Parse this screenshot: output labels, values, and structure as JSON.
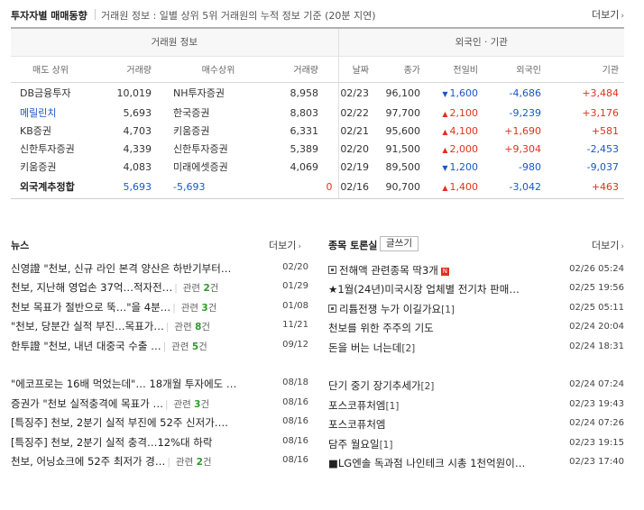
{
  "trade_section": {
    "title": "투자자별 매매동향",
    "subtitle": "거래원 정보 : 일별 상위 5위 거래원의 누적 정보 기준 (20분 지연)",
    "more_label": "더보기"
  },
  "broker_group": "거래원 정보",
  "foreign_group": "외국인 · 기관",
  "columns": {
    "sell_top": "매도 상위",
    "sell_vol": "거래량",
    "buy_top": "매수상위",
    "buy_vol": "거래량",
    "date": "날짜",
    "close": "종가",
    "change": "전일비",
    "foreign": "외국인",
    "inst": "기관"
  },
  "rows": [
    {
      "sell_name": "DB금융투자",
      "sell_vol": "10,019",
      "buy_name": "NH투자증권",
      "buy_vol": "8,958",
      "date": "02/23",
      "close": "96,100",
      "dir": "▼",
      "chg": "1,600",
      "foreign": "-4,686",
      "inst": "+3,484"
    },
    {
      "sell_name": "메릴린치",
      "sell_vol": "5,693",
      "buy_name": "한국증권",
      "buy_vol": "8,803",
      "date": "02/22",
      "close": "97,700",
      "dir": "▲",
      "chg": "2,100",
      "foreign": "-9,239",
      "inst": "+3,176"
    },
    {
      "sell_name": "KB증권",
      "sell_vol": "4,703",
      "buy_name": "키움증권",
      "buy_vol": "6,331",
      "date": "02/21",
      "close": "95,600",
      "dir": "▲",
      "chg": "4,100",
      "foreign": "+1,690",
      "inst": "+581"
    },
    {
      "sell_name": "신한투자증권",
      "sell_vol": "4,339",
      "buy_name": "신한투자증권",
      "buy_vol": "5,389",
      "date": "02/20",
      "close": "91,500",
      "dir": "▲",
      "chg": "2,000",
      "foreign": "+9,304",
      "inst": "-2,453"
    },
    {
      "sell_name": "키움증권",
      "sell_vol": "4,083",
      "buy_name": "미래에셋증권",
      "buy_vol": "4,069",
      "date": "02/19",
      "close": "89,500",
      "dir": "▼",
      "chg": "1,200",
      "foreign": "-980",
      "inst": "-9,037"
    }
  ],
  "foot": {
    "label": "외국계추정합",
    "sell": "5,693",
    "buy": "-5,693",
    "net": "0",
    "date": "02/16",
    "close": "90,700",
    "dir": "▲",
    "chg": "1,400",
    "foreign": "-3,042",
    "inst": "+463"
  },
  "news": {
    "title": "뉴스",
    "more_label": "더보기",
    "related_prefix": "관련",
    "related_suffix": "건",
    "items": [
      {
        "text": "신영證 \"천보, 신규 라인 본격 양산은 하반기부터…",
        "date": "02/20",
        "related": ""
      },
      {
        "text": "천보, 지난해 영업손 37억…적자전…",
        "date": "01/29",
        "related": "2"
      },
      {
        "text": "천보 목표가 절반으로 뚝…\"을 4분…",
        "date": "01/08",
        "related": "3"
      },
      {
        "text": "\"천보, 당분간 실적 부진…목표가…",
        "date": "11/21",
        "related": "8"
      },
      {
        "text": "한투證 \"천보, 내년 대중국 수출 …",
        "date": "09/12",
        "related": "5"
      },
      {
        "text": "\"에코프로는 16배 먹었는데\"… 18개월 투자에도 …",
        "date": "08/18",
        "related": ""
      },
      {
        "text": "증권가 \"천보 실적충격에 목표가 …",
        "date": "08/16",
        "related": "3"
      },
      {
        "text": "[특징주] 천보, 2분기 실적 부진에 52주 신저가….",
        "date": "08/16",
        "related": ""
      },
      {
        "text": "[특징주] 천보, 2분기 실적 충격…12%대 하락",
        "date": "08/16",
        "related": ""
      },
      {
        "text": "천보, 어닝쇼크에 52주 최저가 경…",
        "date": "08/16",
        "related": "2"
      }
    ]
  },
  "board": {
    "title": "종목 토론실",
    "write_label": "글쓰기",
    "more_label": "더보기",
    "items": [
      {
        "prefix": "box",
        "text": "전해액 관련종목 딱3개",
        "badge": "N",
        "comments": "",
        "date": "02/26 05:24"
      },
      {
        "prefix": "★",
        "text": "1월(24년)미국시장 업체별 전기차 판매…",
        "badge": "",
        "comments": "",
        "date": "02/25 19:56"
      },
      {
        "prefix": "box",
        "text": "리튬전쟁 누가 이길가요",
        "badge": "",
        "comments": "[1]",
        "date": "02/25 05:11"
      },
      {
        "prefix": "",
        "text": "천보를 위한 주주의 기도",
        "badge": "",
        "comments": "",
        "date": "02/24 20:04"
      },
      {
        "prefix": "",
        "text": "돈을 버는 너는데",
        "badge": "",
        "comments": "[2]",
        "date": "02/24 18:31"
      },
      {
        "prefix": "",
        "text": "단기 중기 장기추세가",
        "badge": "",
        "comments": "[2]",
        "date": "02/24 07:24"
      },
      {
        "prefix": "",
        "text": "포스코퓨처엠",
        "badge": "",
        "comments": "[1]",
        "date": "02/23 19:43"
      },
      {
        "prefix": "",
        "text": "포스코퓨처엠",
        "badge": "",
        "comments": "",
        "date": "02/24 07:26"
      },
      {
        "prefix": "",
        "text": "담주 월요일",
        "badge": "",
        "comments": "[1]",
        "date": "02/23 19:15"
      },
      {
        "prefix": "■",
        "text": "LG엔솔 독과점 나인테크 시총 1천억원이…",
        "badge": "",
        "comments": "",
        "date": "02/23 17:40"
      }
    ]
  },
  "colors": {
    "up": "#e0311e",
    "down": "#1a56c6",
    "related_count": "#2f9a2a"
  }
}
